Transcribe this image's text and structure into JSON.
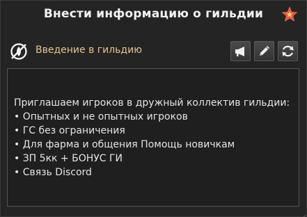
{
  "window": {
    "title": "Внести информацию о гильдии"
  },
  "section": {
    "label": "Введение в гильдию"
  },
  "toolbar": {
    "buttons": [
      "megaphone-icon",
      "pencil-icon",
      "refresh-icon"
    ]
  },
  "intro": {
    "lines": [
      "Приглашаем игроков в дружный коллектив гильдии:",
      "• Опытных и не опытных игроков",
      "• ГС без ограничения",
      "• Для фарма и общения Помощь новичкам",
      "• ЗП 5кк + БОНУС ГИ",
      "• Связь Discord"
    ]
  },
  "colors": {
    "accent_label": "#e3c58f",
    "star": "#e04a3a",
    "background": "#242424"
  }
}
